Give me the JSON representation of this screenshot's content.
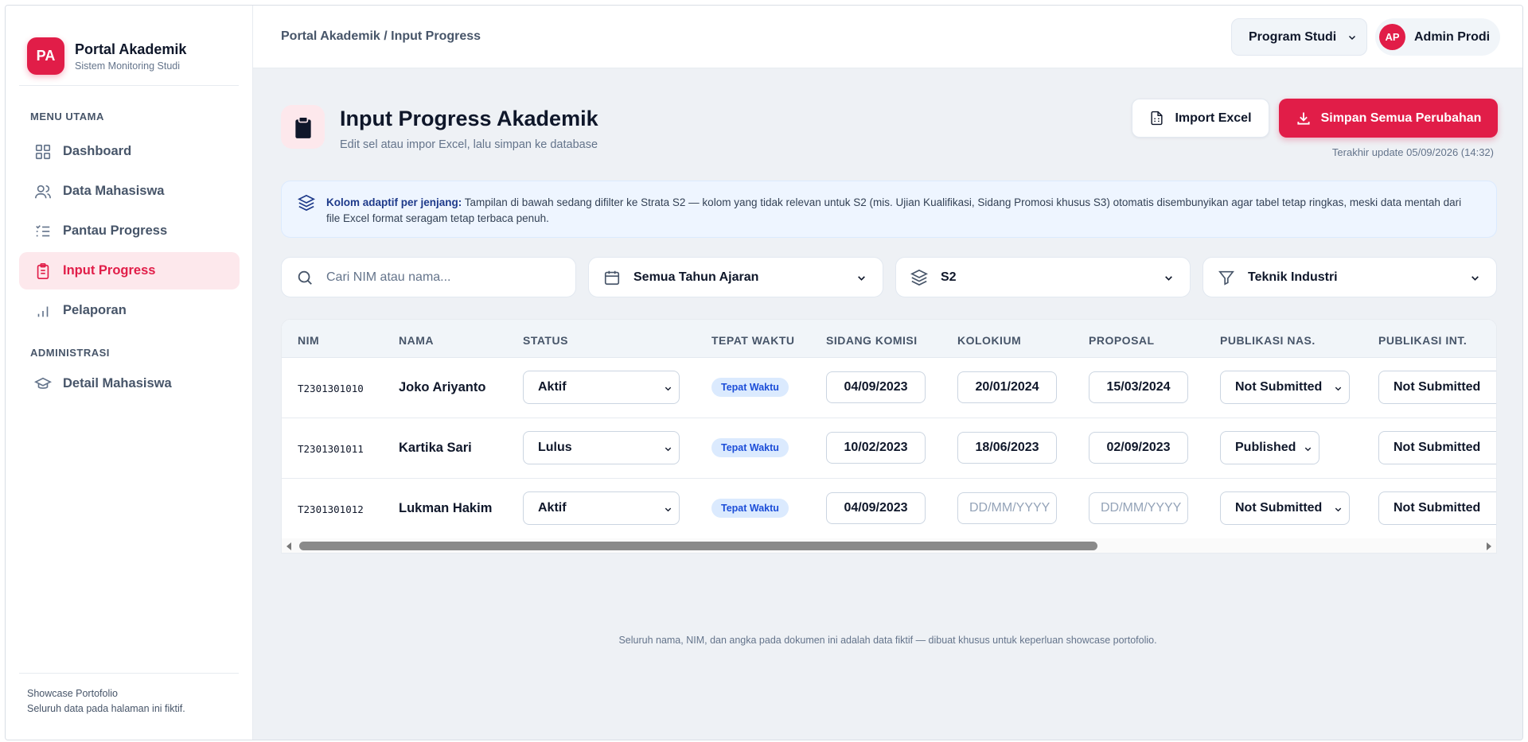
{
  "brand": {
    "logo": "PA",
    "title": "Portal Akademik",
    "subtitle": "Sistem Monitoring Studi"
  },
  "sidebar": {
    "section_main": "MENU UTAMA",
    "items": [
      {
        "label": "Dashboard",
        "icon": "grid-icon"
      },
      {
        "label": "Data Mahasiswa",
        "icon": "users-icon"
      },
      {
        "label": "Pantau Progress",
        "icon": "list-check-icon"
      },
      {
        "label": "Input Progress",
        "icon": "clipboard-icon",
        "active": true
      },
      {
        "label": "Pelaporan",
        "icon": "bar-chart-icon"
      }
    ],
    "section_admin": "ADMINISTRASI",
    "admin_items": [
      {
        "label": "Detail Mahasiswa",
        "icon": "graduation-cap-icon"
      }
    ],
    "footer_line1": "Showcase Portofolio",
    "footer_line2": "Seluruh data pada halaman ini fiktif."
  },
  "topbar": {
    "breadcrumb": "Portal Akademik / Input Progress",
    "program_select": "Program Studi",
    "user_initials": "AP",
    "user_name": "Admin Prodi"
  },
  "page": {
    "title": "Input Progress Akademik",
    "subtitle": "Edit sel atau impor Excel, lalu simpan ke database",
    "import_label": "Import Excel",
    "save_label": "Simpan Semua Perubahan",
    "last_update": "Terakhir update 05/09/2026 (14:32)"
  },
  "info": {
    "strong": "Kolom adaptif per jenjang:",
    "text": " Tampilan di bawah sedang difilter ke Strata S2 — kolom yang tidak relevan untuk S2 (mis. Ujian Kualifikasi, Sidang Promosi khusus S3) otomatis disembunyikan agar tabel tetap ringkas, meski data mentah dari file Excel format seragam tetap terbaca penuh."
  },
  "filters": {
    "search_placeholder": "Cari NIM atau nama...",
    "year": "Semua Tahun Ajaran",
    "level": "S2",
    "department": "Teknik Industri"
  },
  "table": {
    "headers": [
      "NIM",
      "NAMA",
      "STATUS",
      "TEPAT WAKTU",
      "SIDANG KOMISI",
      "KOLOKIUM",
      "PROPOSAL",
      "PUBLIKASI NAS.",
      "PUBLIKASI INT."
    ],
    "date_placeholder": "DD/MM/YYYY",
    "rows": [
      {
        "nim": "T2301301010",
        "nama": "Joko Ariyanto",
        "status": "Aktif",
        "tepat": "Tepat Waktu",
        "sidang": "04/09/2023",
        "kolokium": "20/01/2024",
        "proposal": "15/03/2024",
        "pub_nas": "Not Submitted",
        "pub_int": "Not Submitted"
      },
      {
        "nim": "T2301301011",
        "nama": "Kartika Sari",
        "status": "Lulus",
        "tepat": "Tepat Waktu",
        "sidang": "10/02/2023",
        "kolokium": "18/06/2023",
        "proposal": "02/09/2023",
        "pub_nas": "Published",
        "pub_int": "Not Submitted"
      },
      {
        "nim": "T2301301012",
        "nama": "Lukman Hakim",
        "status": "Aktif",
        "tepat": "Tepat Waktu",
        "sidang": "04/09/2023",
        "kolokium": "",
        "proposal": "",
        "pub_nas": "Not Submitted",
        "pub_int": "Not Submitted"
      }
    ]
  },
  "disclaimer": "Seluruh nama, NIM, dan angka pada dokumen ini adalah data fiktif — dibuat khusus untuk keperluan showcase portofolio.",
  "colors": {
    "accent": "#e11d48",
    "info_bg": "#eef5ff",
    "badge_bg": "#dbeafe",
    "badge_text": "#1d4ed8"
  }
}
